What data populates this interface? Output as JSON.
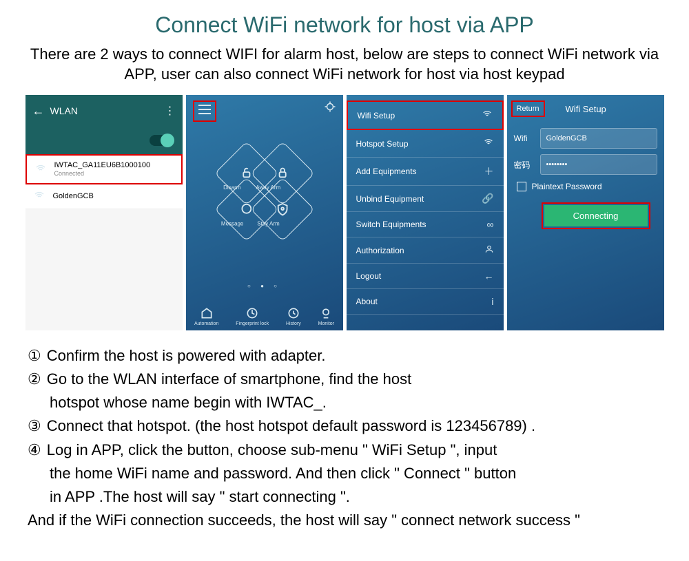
{
  "title": "Connect WiFi network for host via APP",
  "subtitle": "There are 2 ways to connect WIFI for alarm host, below are steps to connect WiFi network via APP, user can also connect WiFi network for host via host keypad",
  "screen1": {
    "bar_title": "WLAN",
    "net1": {
      "name": "IWTAC_GA11EU6B1000100",
      "status": "Connected"
    },
    "net2": {
      "name": "GoldenGCB"
    }
  },
  "screen2": {
    "diamond": {
      "top": "Away Arm",
      "left": "Disarm",
      "right": "Stay Arm",
      "bottom": "Message"
    },
    "nav": [
      "Automation",
      "Fingerprint lock",
      "History",
      "Monitor"
    ]
  },
  "screen3": {
    "items": [
      "Wifi Setup",
      "Hotspot Setup",
      "Add Equipments",
      "Unbind Equipment",
      "Switch Equipments",
      "Authorization",
      "Logout",
      "About"
    ]
  },
  "screen4": {
    "return": "Return",
    "title": "Wifi Setup",
    "wifi_label": "Wifi",
    "wifi_value": "GoldenGCB",
    "pwd_label": "密码",
    "pwd_value": "••••••••",
    "check_label": "Plaintext Password",
    "button": "Connecting"
  },
  "steps": {
    "s1n": "①",
    "s1": "Confirm the host is powered with adapter.",
    "s2n": "②",
    "s2a": "Go to the WLAN interface of smartphone, find the host",
    "s2b": "hotspot whose name begin with IWTAC_.",
    "s3n": "③",
    "s3": "Connect that hotspot. (the host hotspot default password is 123456789) .",
    "s4n": "④",
    "s4a": "Log in APP, click the      button, choose sub-menu \" WiFi Setup \", input",
    "s4b": "the home WiFi name and password. And then click \" Connect \" button",
    "s4c": "in APP .The host will say \"  start connecting \".",
    "last": "And if the WiFi connection succeeds, the host will say \" connect network success \""
  }
}
